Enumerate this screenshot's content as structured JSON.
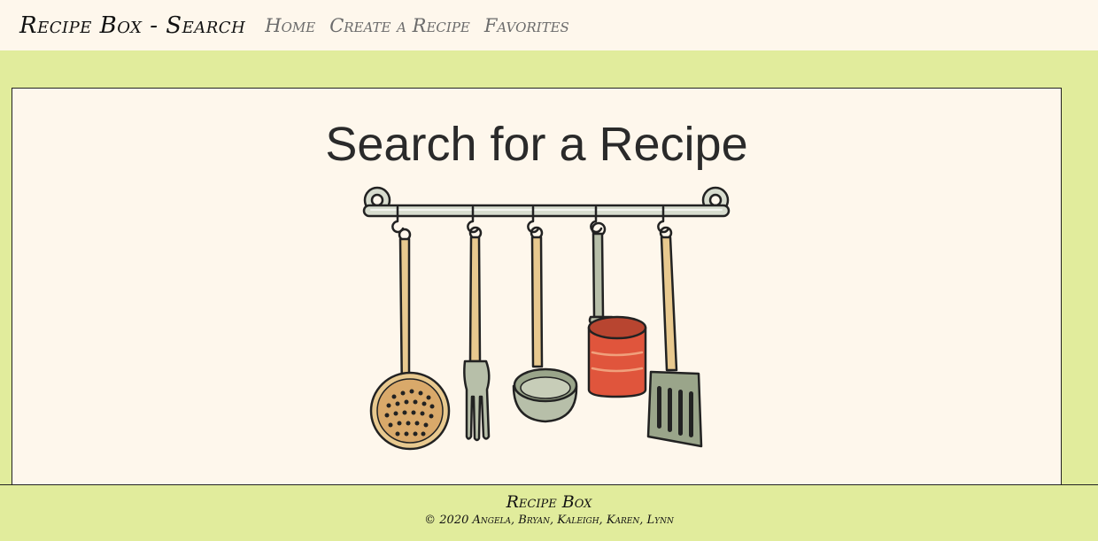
{
  "nav": {
    "brand": "Recipe Box - Search",
    "links": [
      "Home",
      "Create a Recipe",
      "Favorites"
    ]
  },
  "main": {
    "title": "Search for a Recipe",
    "illustration_icon": "hanging-kitchen-utensils-icon"
  },
  "footer": {
    "title": "Recipe Box",
    "credit": "© 2020 Angela, Bryan, Kaleigh, Karen, Lynn"
  },
  "colors": {
    "page_background": "#e1ec9c",
    "panel_background": "#fef7ec",
    "copper_pan": "#e0553c",
    "wooden_handle": "#e8c98f",
    "metal": "#b7bfa9"
  }
}
